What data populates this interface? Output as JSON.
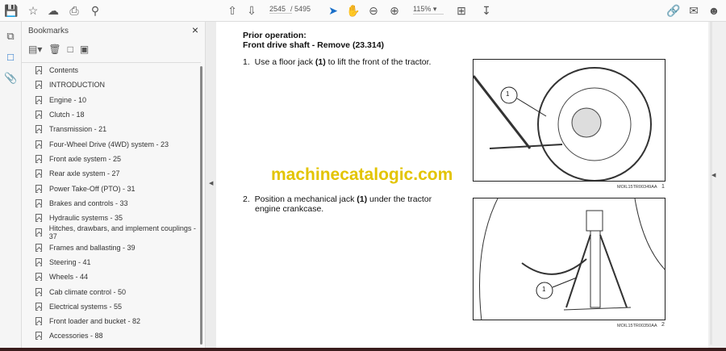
{
  "toolbar": {
    "page_current": "2545",
    "page_total": "/ 5495",
    "zoom": "115%"
  },
  "bookmarks": {
    "title": "Bookmarks",
    "items": [
      "Contents",
      "INTRODUCTION",
      "Engine - 10",
      "Clutch - 18",
      "Transmission - 21",
      "Four-Wheel Drive (4WD) system - 23",
      "Front axle system - 25",
      "Rear axle system - 27",
      "Power Take-Off (PTO) - 31",
      "Brakes and controls - 33",
      "Hydraulic systems - 35",
      "Hitches, drawbars, and implement couplings - 37",
      "Frames and ballasting - 39",
      "Steering - 41",
      "Wheels - 44",
      "Cab climate control - 50",
      "Electrical systems - 55",
      "Front loader and bucket - 82",
      "Accessories - 88"
    ]
  },
  "doc": {
    "prior": "Prior operation:",
    "heading": "Front drive shaft - Remove (23.314)",
    "step1_num": "1.",
    "step1_a": "Use a floor jack ",
    "step1_b": "(1)",
    "step1_c": " to lift the front of the tractor.",
    "step2_num": "2.",
    "step2_a": "Position a mechanical jack ",
    "step2_b": "(1)",
    "step2_c": " under the tractor engine crankcase.",
    "fig1_code": "MOIL15TR00349AA",
    "fig1_num": "1",
    "fig2_code": "MOIL15TR00350AA",
    "fig2_num": "2",
    "callout": "1",
    "watermark": "machinecatalogic.com"
  }
}
